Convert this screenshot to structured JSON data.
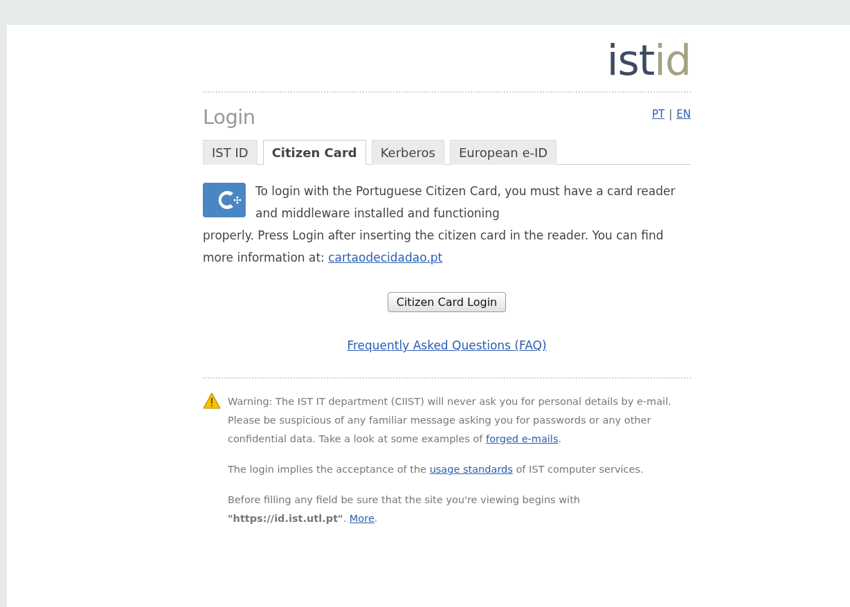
{
  "logo": {
    "part_1": "ist",
    "part_2": "id"
  },
  "heading": "Login",
  "languages": [
    {
      "label": "PT"
    },
    {
      "label": "EN"
    }
  ],
  "language_separator": "|",
  "tabs": [
    {
      "label": "IST ID",
      "selected": false
    },
    {
      "label": "Citizen Card",
      "selected": true
    },
    {
      "label": "Kerberos",
      "selected": false
    },
    {
      "label": "European e-ID",
      "selected": false
    }
  ],
  "intro": {
    "text_1": "To login with the Portuguese Citizen Card, you must have a card reader and middleware installed and functioning",
    "text_2": "properly. Press Login after inserting the citizen card in the reader. You can find more information at: ",
    "link": "cartaodecidadao.pt"
  },
  "login_button": "Citizen Card Login",
  "faq_link": "Frequently Asked Questions (FAQ)",
  "notes": [
    {
      "kind": "warning",
      "before": "Warning: The IST IT department (CIIST) will never ask you for personal details by e-mail. Please be suspicious of any familiar message asking you for passwords or any other confidential data. Take a look at some examples of ",
      "link": "forged e-mails",
      "after": "."
    },
    {
      "kind": "plain",
      "before": "The login implies the acceptance of the ",
      "link": "usage standards",
      "after": " of IST computer services."
    },
    {
      "kind": "plain",
      "before": "Before filling any field be sure that the site you're viewing begins with **\"https://id.ist.utl.pt\"**. ",
      "link": "More",
      "after": "."
    }
  ]
}
